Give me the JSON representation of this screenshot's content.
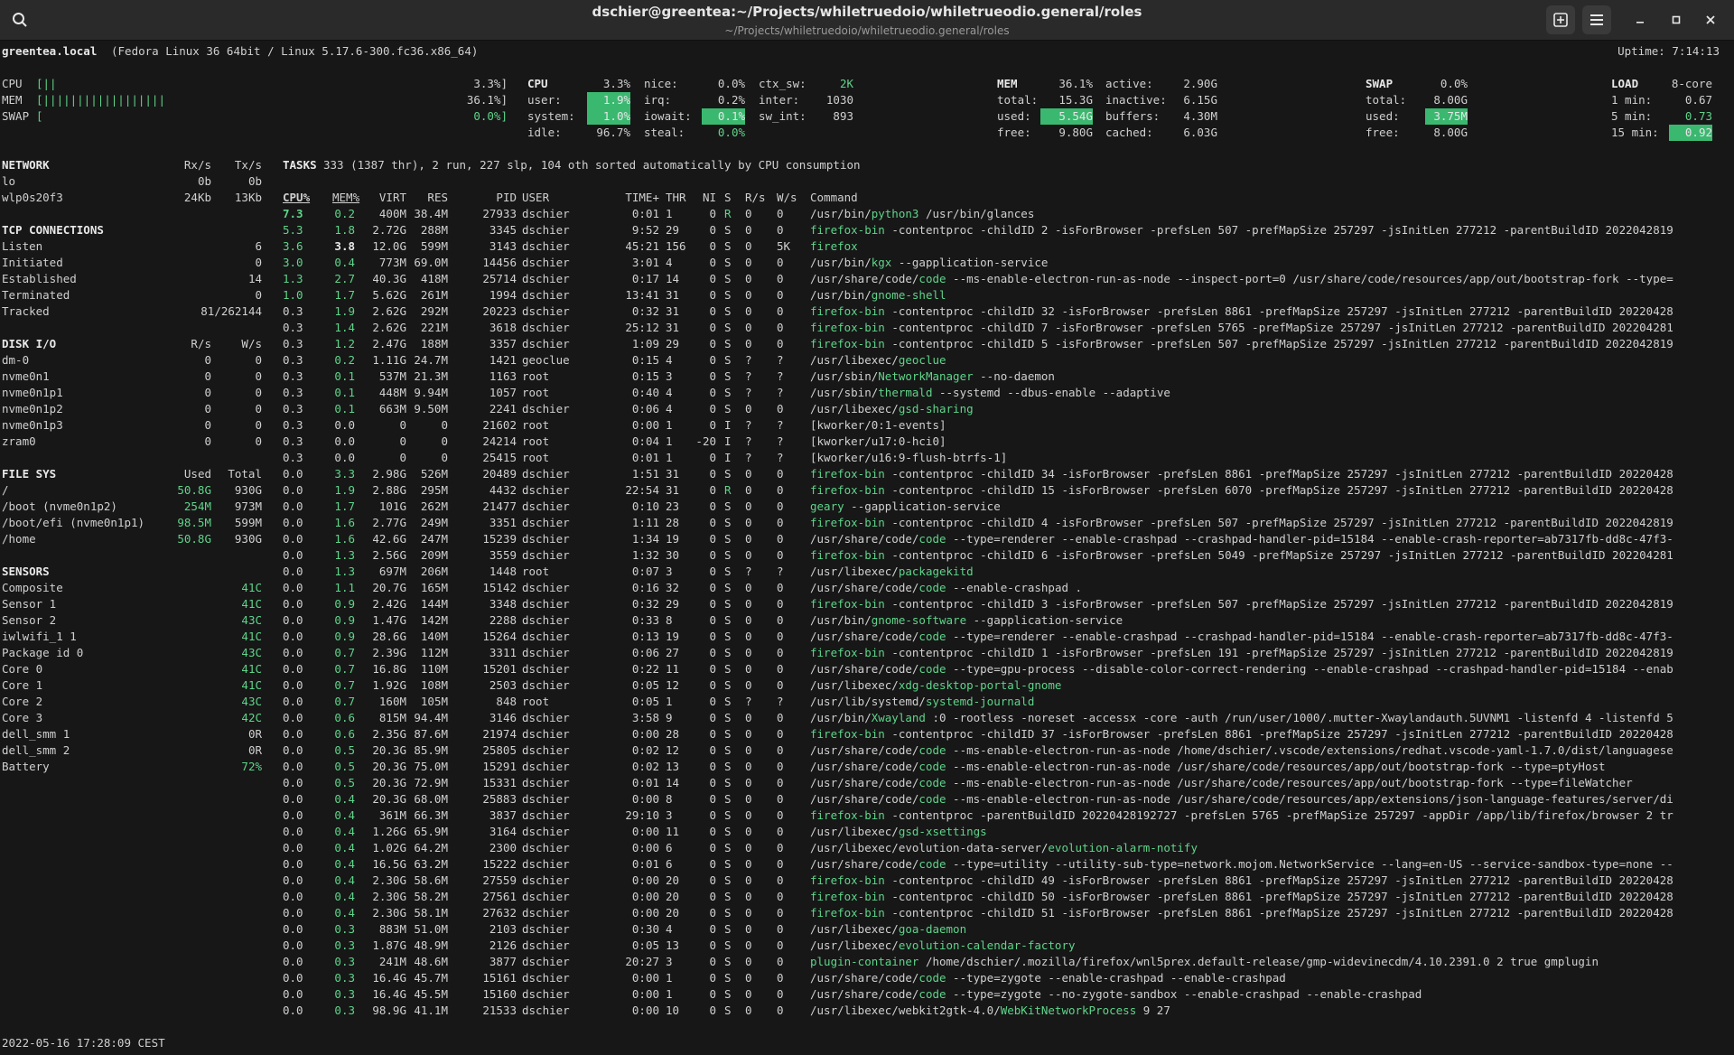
{
  "window": {
    "title": "dschier@greentea:~/Projects/whiletruedoio/whiletrueodio.general/roles",
    "subtitle": "~/Projects/whiletruedoio/whiletrueodio.general/roles"
  },
  "host": {
    "name": "greentea.local",
    "os": "(Fedora Linux 36 64bit / Linux 5.17.6-300.fc36.x86_64)",
    "uptime": "Uptime: 7:14:13"
  },
  "quicklook": {
    "cpu_label": "CPU",
    "cpu_bar": "[||",
    "cpu_pct": "3.3%]",
    "mem_label": "MEM",
    "mem_bar": "[||||||||||||||||||",
    "mem_pct": "36.1%]",
    "swap_label": "SWAP",
    "swap_bar": "[",
    "swap_pct": "0.0%]"
  },
  "cpu": {
    "title": "CPU",
    "total": "3.3%",
    "user_l": "user:",
    "user": "1.9%",
    "system_l": "system:",
    "system": "1.0%",
    "idle_l": "idle:",
    "idle": "96.7%",
    "nice_l": "nice:",
    "nice": "0.0%",
    "irq_l": "irq:",
    "irq": "0.2%",
    "iowait_l": "iowait:",
    "iowait": "0.1%",
    "steal_l": "steal:",
    "steal": "0.0%",
    "ctx_l": "ctx_sw:",
    "ctx": "2K",
    "inter_l": "inter:",
    "inter": "1030",
    "swint_l": "sw_int:",
    "swint": "893"
  },
  "mem": {
    "title": "MEM",
    "pct": "36.1%",
    "total_l": "total:",
    "total": "15.3G",
    "used_l": "used:",
    "used": "5.54G",
    "free_l": "free:",
    "free": "9.80G",
    "active_l": "active:",
    "active": "2.90G",
    "inactive_l": "inactive:",
    "inactive": "6.15G",
    "buffers_l": "buffers:",
    "buffers": "4.30M",
    "cached_l": "cached:",
    "cached": "6.03G"
  },
  "swap": {
    "title": "SWAP",
    "pct": "0.0%",
    "total_l": "total:",
    "total": "8.00G",
    "used_l": "used:",
    "used": "3.75M",
    "free_l": "free:",
    "free": "8.00G"
  },
  "load": {
    "title": "LOAD",
    "cores": "8-core",
    "m1_l": "1 min:",
    "m1": "0.67",
    "m5_l": "5 min:",
    "m5": "0.73",
    "m15_l": "15 min:",
    "m15": "0.92"
  },
  "network": {
    "title": "NETWORK",
    "rx_h": "Rx/s",
    "tx_h": "Tx/s",
    "rows": [
      [
        "lo",
        "0b",
        "0b"
      ],
      [
        "wlp0s20f3",
        "24Kb",
        "13Kb"
      ]
    ]
  },
  "tcp": {
    "title": "TCP CONNECTIONS",
    "rows": [
      [
        "Listen",
        "6"
      ],
      [
        "Initiated",
        "0"
      ],
      [
        "Established",
        "14"
      ],
      [
        "Terminated",
        "0"
      ],
      [
        "Tracked",
        "81/262144"
      ]
    ]
  },
  "disk": {
    "title": "DISK I/O",
    "r_h": "R/s",
    "w_h": "W/s",
    "rows": [
      [
        "dm-0",
        "0",
        "0"
      ],
      [
        "nvme0n1",
        "0",
        "0"
      ],
      [
        "nvme0n1p1",
        "0",
        "0"
      ],
      [
        "nvme0n1p2",
        "0",
        "0"
      ],
      [
        "nvme0n1p3",
        "0",
        "0"
      ],
      [
        "zram0",
        "0",
        "0"
      ]
    ]
  },
  "fs": {
    "title": "FILE SYS",
    "used_h": "Used",
    "total_h": "Total",
    "rows": [
      [
        "/",
        "50.8G",
        "930G"
      ],
      [
        "/boot (nvme0n1p2)",
        "254M",
        "973M"
      ],
      [
        "/boot/efi (nvme0n1p1)",
        "98.5M",
        "599M"
      ],
      [
        "/home",
        "50.8G",
        "930G"
      ]
    ]
  },
  "sensors": {
    "title": "SENSORS",
    "rows": [
      [
        "Composite",
        "41C"
      ],
      [
        "Sensor 1",
        "41C"
      ],
      [
        "Sensor 2",
        "43C"
      ],
      [
        "iwlwifi_1 1",
        "41C"
      ],
      [
        "Package id 0",
        "43C"
      ],
      [
        "Core 0",
        "41C"
      ],
      [
        "Core 1",
        "41C"
      ],
      [
        "Core 2",
        "43C"
      ],
      [
        "Core 3",
        "42C"
      ],
      [
        "dell_smm 1",
        "0R"
      ],
      [
        "dell_smm 2",
        "0R"
      ],
      [
        "Battery",
        "72%"
      ]
    ]
  },
  "tasks": {
    "title": "TASKS",
    "summary": "333 (1387 thr), 2 run, 227 slp, 104 oth sorted automatically by CPU consumption"
  },
  "proc_headers": [
    "CPU%",
    "MEM%",
    "VIRT",
    "RES",
    "PID",
    "USER",
    "TIME+",
    "THR",
    "NI",
    "S",
    "R/s",
    "W/s",
    "Command"
  ],
  "processes": [
    [
      "7.3",
      "0.2",
      "400M",
      "38.4M",
      "27933",
      "dschier",
      "0:01",
      "1",
      "0",
      "R",
      "0",
      "0",
      "/usr/bin/",
      "python3",
      " /usr/bin/glances"
    ],
    [
      "5.3",
      "1.8",
      "2.72G",
      "288M",
      "3345",
      "dschier",
      "9:52",
      "29",
      "0",
      "S",
      "0",
      "0",
      "",
      "firefox-bin",
      " -contentproc -childID 2 -isForBrowser -prefsLen 507 -prefMapSize 257297 -jsInitLen 277212 -parentBuildID 2022042819"
    ],
    [
      "3.6",
      "3.8",
      "12.0G",
      "599M",
      "3143",
      "dschier",
      "45:21",
      "156",
      "0",
      "S",
      "0",
      "5K",
      "",
      "firefox",
      ""
    ],
    [
      "3.0",
      "0.4",
      "773M",
      "69.0M",
      "14456",
      "dschier",
      "3:01",
      "4",
      "0",
      "S",
      "0",
      "0",
      "/usr/bin/",
      "kgx",
      " --gapplication-service"
    ],
    [
      "1.3",
      "2.7",
      "40.3G",
      "418M",
      "25714",
      "dschier",
      "0:17",
      "14",
      "0",
      "S",
      "0",
      "0",
      "/usr/share/code/",
      "code",
      " --ms-enable-electron-run-as-node --inspect-port=0 /usr/share/code/resources/app/out/bootstrap-fork --type="
    ],
    [
      "1.0",
      "1.7",
      "5.62G",
      "261M",
      "1994",
      "dschier",
      "13:41",
      "31",
      "0",
      "S",
      "0",
      "0",
      "/usr/bin/",
      "gnome-shell",
      ""
    ],
    [
      "0.3",
      "1.9",
      "2.62G",
      "292M",
      "20223",
      "dschier",
      "0:32",
      "31",
      "0",
      "S",
      "0",
      "0",
      "",
      "firefox-bin",
      " -contentproc -childID 32 -isForBrowser -prefsLen 8861 -prefMapSize 257297 -jsInitLen 277212 -parentBuildID 20220428"
    ],
    [
      "0.3",
      "1.4",
      "2.62G",
      "221M",
      "3618",
      "dschier",
      "25:12",
      "31",
      "0",
      "S",
      "0",
      "0",
      "",
      "firefox-bin",
      " -contentproc -childID 7 -isForBrowser -prefsLen 5765 -prefMapSize 257297 -jsInitLen 277212 -parentBuildID 202204281"
    ],
    [
      "0.3",
      "1.2",
      "2.47G",
      "188M",
      "3357",
      "dschier",
      "1:09",
      "29",
      "0",
      "S",
      "0",
      "0",
      "",
      "firefox-bin",
      " -contentproc -childID 5 -isForBrowser -prefsLen 507 -prefMapSize 257297 -jsInitLen 277212 -parentBuildID 2022042819"
    ],
    [
      "0.3",
      "0.2",
      "1.11G",
      "24.7M",
      "1421",
      "geoclue",
      "0:15",
      "4",
      "0",
      "S",
      "?",
      "?",
      "/usr/libexec/",
      "geoclue",
      ""
    ],
    [
      "0.3",
      "0.1",
      "537M",
      "21.3M",
      "1163",
      "root",
      "0:15",
      "3",
      "0",
      "S",
      "?",
      "?",
      "/usr/sbin/",
      "NetworkManager",
      " --no-daemon"
    ],
    [
      "0.3",
      "0.1",
      "448M",
      "9.94M",
      "1057",
      "root",
      "0:40",
      "4",
      "0",
      "S",
      "?",
      "?",
      "/usr/sbin/",
      "thermald",
      " --systemd --dbus-enable --adaptive"
    ],
    [
      "0.3",
      "0.1",
      "663M",
      "9.50M",
      "2241",
      "dschier",
      "0:06",
      "4",
      "0",
      "S",
      "0",
      "0",
      "/usr/libexec/",
      "gsd-sharing",
      ""
    ],
    [
      "0.3",
      "0.0",
      "0",
      "0",
      "21602",
      "root",
      "0:00",
      "1",
      "0",
      "I",
      "?",
      "?",
      "[kworker/0:1-events]",
      "",
      ""
    ],
    [
      "0.3",
      "0.0",
      "0",
      "0",
      "24214",
      "root",
      "0:04",
      "1",
      "-20",
      "I",
      "?",
      "?",
      "[kworker/u17:0-hci0]",
      "",
      ""
    ],
    [
      "0.3",
      "0.0",
      "0",
      "0",
      "25415",
      "root",
      "0:01",
      "1",
      "0",
      "I",
      "?",
      "?",
      "[kworker/u16:9-flush-btrfs-1]",
      "",
      ""
    ],
    [
      "0.0",
      "3.3",
      "2.98G",
      "526M",
      "20489",
      "dschier",
      "1:51",
      "31",
      "0",
      "S",
      "0",
      "0",
      "",
      "firefox-bin",
      " -contentproc -childID 34 -isForBrowser -prefsLen 8861 -prefMapSize 257297 -jsInitLen 277212 -parentBuildID 20220428"
    ],
    [
      "0.0",
      "1.9",
      "2.88G",
      "295M",
      "4432",
      "dschier",
      "22:54",
      "31",
      "0",
      "R",
      "0",
      "0",
      "",
      "firefox-bin",
      " -contentproc -childID 15 -isForBrowser -prefsLen 6070 -prefMapSize 257297 -jsInitLen 277212 -parentBuildID 20220428"
    ],
    [
      "0.0",
      "1.7",
      "101G",
      "262M",
      "21477",
      "dschier",
      "0:10",
      "23",
      "0",
      "S",
      "0",
      "0",
      "",
      "geary",
      " --gapplication-service"
    ],
    [
      "0.0",
      "1.6",
      "2.77G",
      "249M",
      "3351",
      "dschier",
      "1:11",
      "28",
      "0",
      "S",
      "0",
      "0",
      "",
      "firefox-bin",
      " -contentproc -childID 4 -isForBrowser -prefsLen 507 -prefMapSize 257297 -jsInitLen 277212 -parentBuildID 2022042819"
    ],
    [
      "0.0",
      "1.6",
      "42.6G",
      "247M",
      "15239",
      "dschier",
      "1:34",
      "19",
      "0",
      "S",
      "0",
      "0",
      "/usr/share/code/",
      "code",
      " --type=renderer --enable-crashpad --crashpad-handler-pid=15184 --enable-crash-reporter=ab7317fb-dd8c-47f3-"
    ],
    [
      "0.0",
      "1.3",
      "2.56G",
      "209M",
      "3559",
      "dschier",
      "1:32",
      "30",
      "0",
      "S",
      "0",
      "0",
      "",
      "firefox-bin",
      " -contentproc -childID 6 -isForBrowser -prefsLen 5049 -prefMapSize 257297 -jsInitLen 277212 -parentBuildID 202204281"
    ],
    [
      "0.0",
      "1.3",
      "697M",
      "206M",
      "1448",
      "root",
      "0:07",
      "3",
      "0",
      "S",
      "?",
      "?",
      "/usr/libexec/",
      "packagekitd",
      ""
    ],
    [
      "0.0",
      "1.1",
      "20.7G",
      "165M",
      "15142",
      "dschier",
      "0:16",
      "32",
      "0",
      "S",
      "0",
      "0",
      "/usr/share/code/",
      "code",
      " --enable-crashpad ."
    ],
    [
      "0.0",
      "0.9",
      "2.42G",
      "144M",
      "3348",
      "dschier",
      "0:32",
      "29",
      "0",
      "S",
      "0",
      "0",
      "",
      "firefox-bin",
      " -contentproc -childID 3 -isForBrowser -prefsLen 507 -prefMapSize 257297 -jsInitLen 277212 -parentBuildID 2022042819"
    ],
    [
      "0.0",
      "0.9",
      "1.47G",
      "142M",
      "2288",
      "dschier",
      "0:33",
      "8",
      "0",
      "S",
      "0",
      "0",
      "/usr/bin/",
      "gnome-software",
      " --gapplication-service"
    ],
    [
      "0.0",
      "0.9",
      "28.6G",
      "140M",
      "15264",
      "dschier",
      "0:13",
      "19",
      "0",
      "S",
      "0",
      "0",
      "/usr/share/code/",
      "code",
      " --type=renderer --enable-crashpad --crashpad-handler-pid=15184 --enable-crash-reporter=ab7317fb-dd8c-47f3-"
    ],
    [
      "0.0",
      "0.7",
      "2.39G",
      "112M",
      "3311",
      "dschier",
      "0:06",
      "27",
      "0",
      "S",
      "0",
      "0",
      "",
      "firefox-bin",
      " -contentproc -childID 1 -isForBrowser -prefsLen 191 -prefMapSize 257297 -jsInitLen 277212 -parentBuildID 2022042819"
    ],
    [
      "0.0",
      "0.7",
      "16.8G",
      "110M",
      "15201",
      "dschier",
      "0:22",
      "11",
      "0",
      "S",
      "0",
      "0",
      "/usr/share/code/",
      "code",
      " --type=gpu-process --disable-color-correct-rendering --enable-crashpad --crashpad-handler-pid=15184 --enab"
    ],
    [
      "0.0",
      "0.7",
      "1.92G",
      "108M",
      "2503",
      "dschier",
      "0:05",
      "12",
      "0",
      "S",
      "0",
      "0",
      "/usr/libexec/",
      "xdg-desktop-portal-gnome",
      ""
    ],
    [
      "0.0",
      "0.7",
      "160M",
      "105M",
      "848",
      "root",
      "0:05",
      "1",
      "0",
      "S",
      "?",
      "?",
      "/usr/lib/systemd/",
      "systemd-journald",
      ""
    ],
    [
      "0.0",
      "0.6",
      "815M",
      "94.4M",
      "3146",
      "dschier",
      "3:58",
      "9",
      "0",
      "S",
      "0",
      "0",
      "/usr/bin/",
      "Xwayland",
      " :0 -rootless -noreset -accessx -core -auth /run/user/1000/.mutter-Xwaylandauth.5UVNM1 -listenfd 4 -listenfd 5"
    ],
    [
      "0.0",
      "0.6",
      "2.35G",
      "87.6M",
      "21974",
      "dschier",
      "0:00",
      "28",
      "0",
      "S",
      "0",
      "0",
      "",
      "firefox-bin",
      " -contentproc -childID 37 -isForBrowser -prefsLen 8861 -prefMapSize 257297 -jsInitLen 277212 -parentBuildID 20220428"
    ],
    [
      "0.0",
      "0.5",
      "20.3G",
      "85.9M",
      "25805",
      "dschier",
      "0:02",
      "12",
      "0",
      "S",
      "0",
      "0",
      "/usr/share/code/",
      "code",
      " --ms-enable-electron-run-as-node /home/dschier/.vscode/extensions/redhat.vscode-yaml-1.7.0/dist/languagese"
    ],
    [
      "0.0",
      "0.5",
      "20.3G",
      "75.0M",
      "15291",
      "dschier",
      "0:02",
      "13",
      "0",
      "S",
      "0",
      "0",
      "/usr/share/code/",
      "code",
      " --ms-enable-electron-run-as-node /usr/share/code/resources/app/out/bootstrap-fork --type=ptyHost"
    ],
    [
      "0.0",
      "0.5",
      "20.3G",
      "72.9M",
      "15331",
      "dschier",
      "0:01",
      "14",
      "0",
      "S",
      "0",
      "0",
      "/usr/share/code/",
      "code",
      " --ms-enable-electron-run-as-node /usr/share/code/resources/app/out/bootstrap-fork --type=fileWatcher"
    ],
    [
      "0.0",
      "0.4",
      "20.3G",
      "68.0M",
      "25883",
      "dschier",
      "0:00",
      "8",
      "0",
      "S",
      "0",
      "0",
      "/usr/share/code/",
      "code",
      " --ms-enable-electron-run-as-node /usr/share/code/resources/app/extensions/json-language-features/server/di"
    ],
    [
      "0.0",
      "0.4",
      "361M",
      "66.3M",
      "3837",
      "dschier",
      "29:10",
      "3",
      "0",
      "S",
      "0",
      "0",
      "",
      "firefox-bin",
      " -contentproc -parentBuildID 20220428192727 -prefsLen 5765 -prefMapSize 257297 -appDir /app/lib/firefox/browser 2 tr"
    ],
    [
      "0.0",
      "0.4",
      "1.26G",
      "65.9M",
      "3164",
      "dschier",
      "0:00",
      "11",
      "0",
      "S",
      "0",
      "0",
      "/usr/libexec/",
      "gsd-xsettings",
      ""
    ],
    [
      "0.0",
      "0.4",
      "1.02G",
      "64.2M",
      "2300",
      "dschier",
      "0:00",
      "6",
      "0",
      "S",
      "0",
      "0",
      "/usr/libexec/evolution-data-server/",
      "evolution-alarm-notify",
      ""
    ],
    [
      "0.0",
      "0.4",
      "16.5G",
      "63.2M",
      "15222",
      "dschier",
      "0:01",
      "6",
      "0",
      "S",
      "0",
      "0",
      "/usr/share/code/",
      "code",
      " --type=utility --utility-sub-type=network.mojom.NetworkService --lang=en-US --service-sandbox-type=none --"
    ],
    [
      "0.0",
      "0.4",
      "2.30G",
      "58.6M",
      "27559",
      "dschier",
      "0:00",
      "20",
      "0",
      "S",
      "0",
      "0",
      "",
      "firefox-bin",
      " -contentproc -childID 49 -isForBrowser -prefsLen 8861 -prefMapSize 257297 -jsInitLen 277212 -parentBuildID 20220428"
    ],
    [
      "0.0",
      "0.4",
      "2.30G",
      "58.2M",
      "27561",
      "dschier",
      "0:00",
      "20",
      "0",
      "S",
      "0",
      "0",
      "",
      "firefox-bin",
      " -contentproc -childID 50 -isForBrowser -prefsLen 8861 -prefMapSize 257297 -jsInitLen 277212 -parentBuildID 20220428"
    ],
    [
      "0.0",
      "0.4",
      "2.30G",
      "58.1M",
      "27632",
      "dschier",
      "0:00",
      "20",
      "0",
      "S",
      "0",
      "0",
      "",
      "firefox-bin",
      " -contentproc -childID 51 -isForBrowser -prefsLen 8861 -prefMapSize 257297 -jsInitLen 277212 -parentBuildID 20220428"
    ],
    [
      "0.0",
      "0.3",
      "883M",
      "51.0M",
      "2103",
      "dschier",
      "0:30",
      "4",
      "0",
      "S",
      "0",
      "0",
      "/usr/libexec/",
      "goa-daemon",
      ""
    ],
    [
      "0.0",
      "0.3",
      "1.87G",
      "48.9M",
      "2126",
      "dschier",
      "0:05",
      "13",
      "0",
      "S",
      "0",
      "0",
      "/usr/libexec/",
      "evolution-calendar-factory",
      ""
    ],
    [
      "0.0",
      "0.3",
      "241M",
      "48.6M",
      "3877",
      "dschier",
      "20:27",
      "3",
      "0",
      "S",
      "0",
      "0",
      "",
      "plugin-container",
      " /home/dschier/.mozilla/firefox/wnl5prex.default-release/gmp-widevinecdm/4.10.2391.0 2 true gmplugin"
    ],
    [
      "0.0",
      "0.3",
      "16.4G",
      "45.7M",
      "15161",
      "dschier",
      "0:00",
      "1",
      "0",
      "S",
      "0",
      "0",
      "/usr/share/code/",
      "code",
      " --type=zygote --enable-crashpad --enable-crashpad"
    ],
    [
      "0.0",
      "0.3",
      "16.4G",
      "45.5M",
      "15160",
      "dschier",
      "0:00",
      "1",
      "0",
      "S",
      "0",
      "0",
      "/usr/share/code/",
      "code",
      " --type=zygote --no-zygote-sandbox --enable-crashpad --enable-crashpad"
    ],
    [
      "0.0",
      "0.3",
      "98.9G",
      "41.1M",
      "21533",
      "dschier",
      "0:00",
      "10",
      "0",
      "S",
      "0",
      "0",
      "/usr/libexec/webkit2gtk-4.0/",
      "WebKitNetworkProcess",
      " 9 27"
    ]
  ],
  "footer": {
    "datetime": "2022-05-16 17:28:09 CEST"
  }
}
